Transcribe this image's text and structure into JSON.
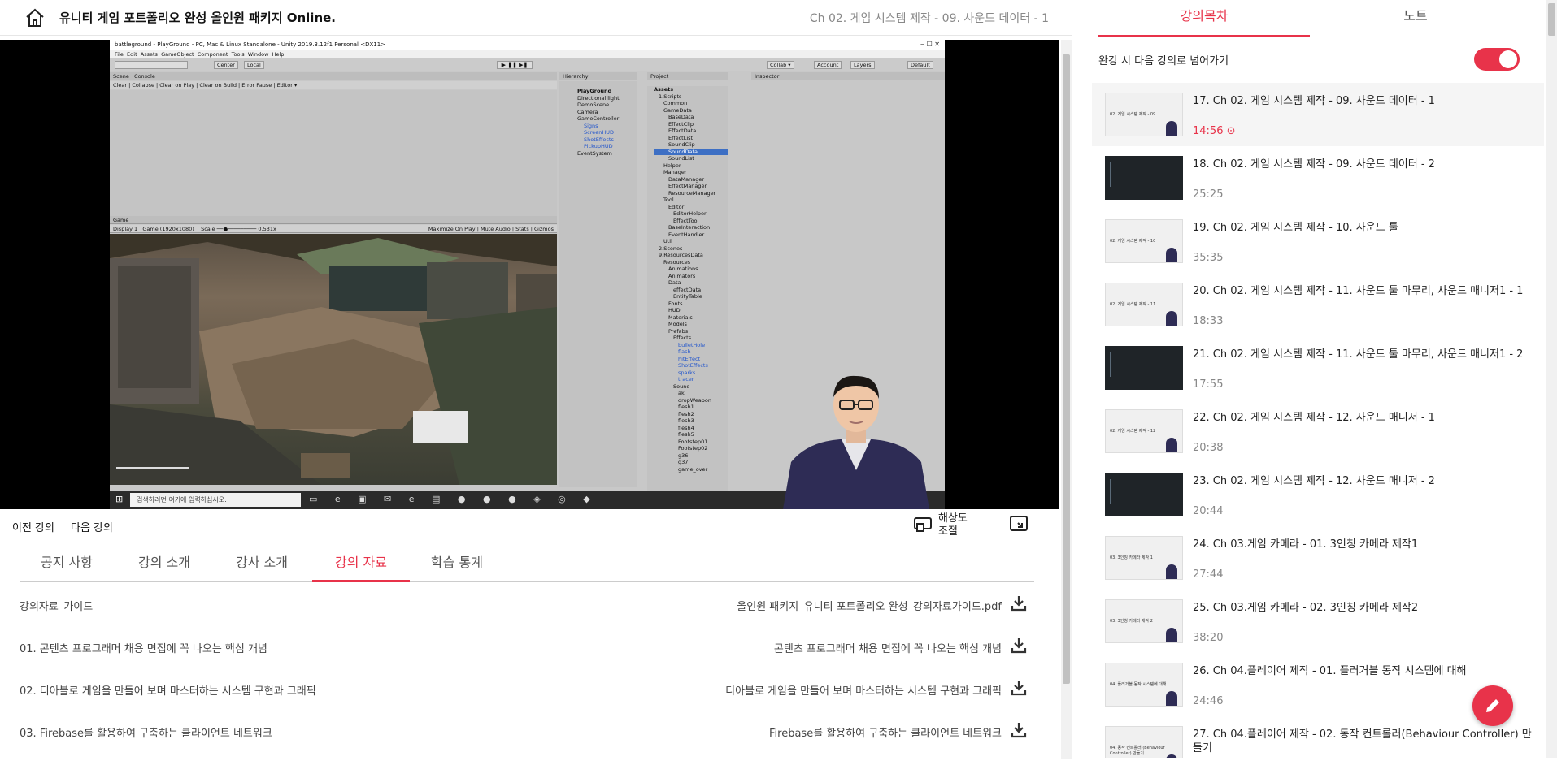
{
  "header": {
    "course_title": "유니티 게임 포트폴리오 완성 올인원 패키지 Online.",
    "lecture_title": "Ch 02. 게임 시스템 제작 - 09. 사운드 데이터 - 1"
  },
  "unity": {
    "window_title": "battleground - PlayGround - PC, Mac & Linux Standalone - Unity 2019.3.12f1 Personal <DX11>",
    "menu": [
      "File",
      "Edit",
      "Assets",
      "GameObject",
      "Component",
      "Tools",
      "Window",
      "Help"
    ],
    "toolbar": {
      "center": "Center",
      "local": "Local",
      "collab": "Collab ▾",
      "account": "Account",
      "layers": "Layers",
      "layout": "Default"
    },
    "tabs": {
      "scene": "Scene",
      "console": "Console",
      "hierarchy": "Hierarchy",
      "project": "Project",
      "inspector": "Inspector",
      "game": "Game"
    },
    "console_buttons": [
      "Clear",
      "Collapse",
      "Clear on Play",
      "Clear on Build",
      "Error Pause",
      "Editor ▾"
    ],
    "game_bar": {
      "display": "Display 1",
      "resolution": "Game (1920x1080)",
      "scale": "Scale",
      "scale_value": "0.531x",
      "maximize": "Maximize On Play",
      "mute": "Mute Audio",
      "stats": "Stats",
      "gizmos": "Gizmos"
    },
    "hierarchy": [
      "PlayGround",
      "Directional light",
      "DemoScene",
      "Camera",
      "GameController",
      "Signs",
      "ScreenHUD",
      "ShotEffects",
      "PickupHUD",
      "EventSystem"
    ],
    "project": [
      "Assets",
      "1.Scripts",
      "Common",
      "GameData",
      "BaseData",
      "EffectClip",
      "EffectData",
      "EffectList",
      "SoundClip",
      "SoundData",
      "SoundList",
      "Helper",
      "Manager",
      "DataManager",
      "EffectManager",
      "ResourceManager",
      "Tool",
      "Editor",
      "EditorHelper",
      "EffectTool",
      "BaseInteraction",
      "EventHandler",
      "Util",
      "2.Scenes",
      "9.ResourcesData",
      "Resources",
      "Animations",
      "Animators",
      "Data",
      "effectData",
      "EntityTable",
      "Fonts",
      "HUD",
      "Materials",
      "Models",
      "Prefabs",
      "Effects",
      "bulletHole",
      "flash",
      "hitEffect",
      "ShotEffects",
      "sparks",
      "tracer",
      "Sound",
      "ak",
      "dropWeapon",
      "flesh1",
      "flesh2",
      "flesh3",
      "flesh4",
      "flesh5",
      "Footstep01",
      "Footstep02",
      "g36",
      "g37",
      "game_over"
    ],
    "taskbar_search": "검색하려면 여기에 입력하십시오."
  },
  "controls": {
    "prev": "이전 강의",
    "next": "다음 강의",
    "resolution": "해상도\n조절"
  },
  "tabs": [
    {
      "label": "공지 사항"
    },
    {
      "label": "강의 소개"
    },
    {
      "label": "강사 소개"
    },
    {
      "label": "강의 자료"
    },
    {
      "label": "학습 통계"
    }
  ],
  "materials": [
    {
      "left": "강의자료_가이드",
      "right": "올인원 패키지_유니티 포트폴리오 완성_강의자료가이드.pdf"
    },
    {
      "left": "01. 콘텐츠 프로그래머 채용 면접에 꼭 나오는 핵심 개념",
      "right": "콘텐츠 프로그래머 채용 면접에 꼭 나오는 핵심 개념"
    },
    {
      "left": "02. 디아블로 게임을 만들어 보며 마스터하는 시스템 구현과 그래픽",
      "right": "디아블로 게임을 만들어 보며 마스터하는 시스템 구현과 그래픽"
    },
    {
      "left": "03. Firebase를 활용하여 구축하는 클라이언트 네트워크",
      "right": "Firebase를 활용하여 구축하는 클라이언트 네트워크"
    }
  ],
  "sidebar": {
    "tab_toc": "강의목차",
    "tab_note": "노트",
    "autoplay": "완강 시 다음 강의로 넘어가기",
    "lectures": [
      {
        "title": "17. Ch 02. 게임 시스템 제작 - 09. 사운드 데이터 - 1",
        "duration": "14:56"
      },
      {
        "title": "18. Ch 02. 게임 시스템 제작 - 09. 사운드 데이터 - 2",
        "duration": "25:25"
      },
      {
        "title": "19. Ch 02. 게임 시스템 제작 - 10. 사운드 툴",
        "duration": "35:35"
      },
      {
        "title": "20. Ch 02. 게임 시스템 제작 - 11. 사운드 툴 마무리, 사운드 매니저1 - 1",
        "duration": "18:33"
      },
      {
        "title": "21. Ch 02. 게임 시스템 제작 - 11. 사운드 툴 마무리, 사운드 매니저1 - 2",
        "duration": "17:55"
      },
      {
        "title": "22. Ch 02. 게임 시스템 제작 - 12. 사운드 매니저 - 1",
        "duration": "20:38"
      },
      {
        "title": "23. Ch 02. 게임 시스템 제작 - 12. 사운드 매니저 - 2",
        "duration": "20:44"
      },
      {
        "title": "24. Ch 03.게임 카메라 - 01. 3인칭 카메라 제작1",
        "duration": "27:44"
      },
      {
        "title": "25. Ch 03.게임 카메라 - 02. 3인칭 카메라 제작2",
        "duration": "38:20"
      },
      {
        "title": "26. Ch 04.플레이어 제작 - 01. 플러거블 동작 시스템에 대해",
        "duration": "24:46"
      },
      {
        "title": "27. Ch 04.플레이어 제작 - 02. 동작 컨트롤러(Behaviour Controller) 만들기",
        "duration": ""
      }
    ],
    "thumb_captions": [
      "02. 게임 시스템 제작 - 09",
      "",
      "02. 게임 시스템 제작 - 10",
      "02. 게임 시스템 제작 - 11",
      "",
      "02. 게임 시스템 제작 - 12",
      "",
      "03. 3인칭 카메라 제작 1",
      "03. 3인칭 카메라 제작 2",
      "04. 플러거블 동작 시스템에 대해",
      "04. 동작 컨트롤러 (Behaviour Controller) 만들기"
    ]
  },
  "colors": {
    "accent": "#e8334a"
  }
}
